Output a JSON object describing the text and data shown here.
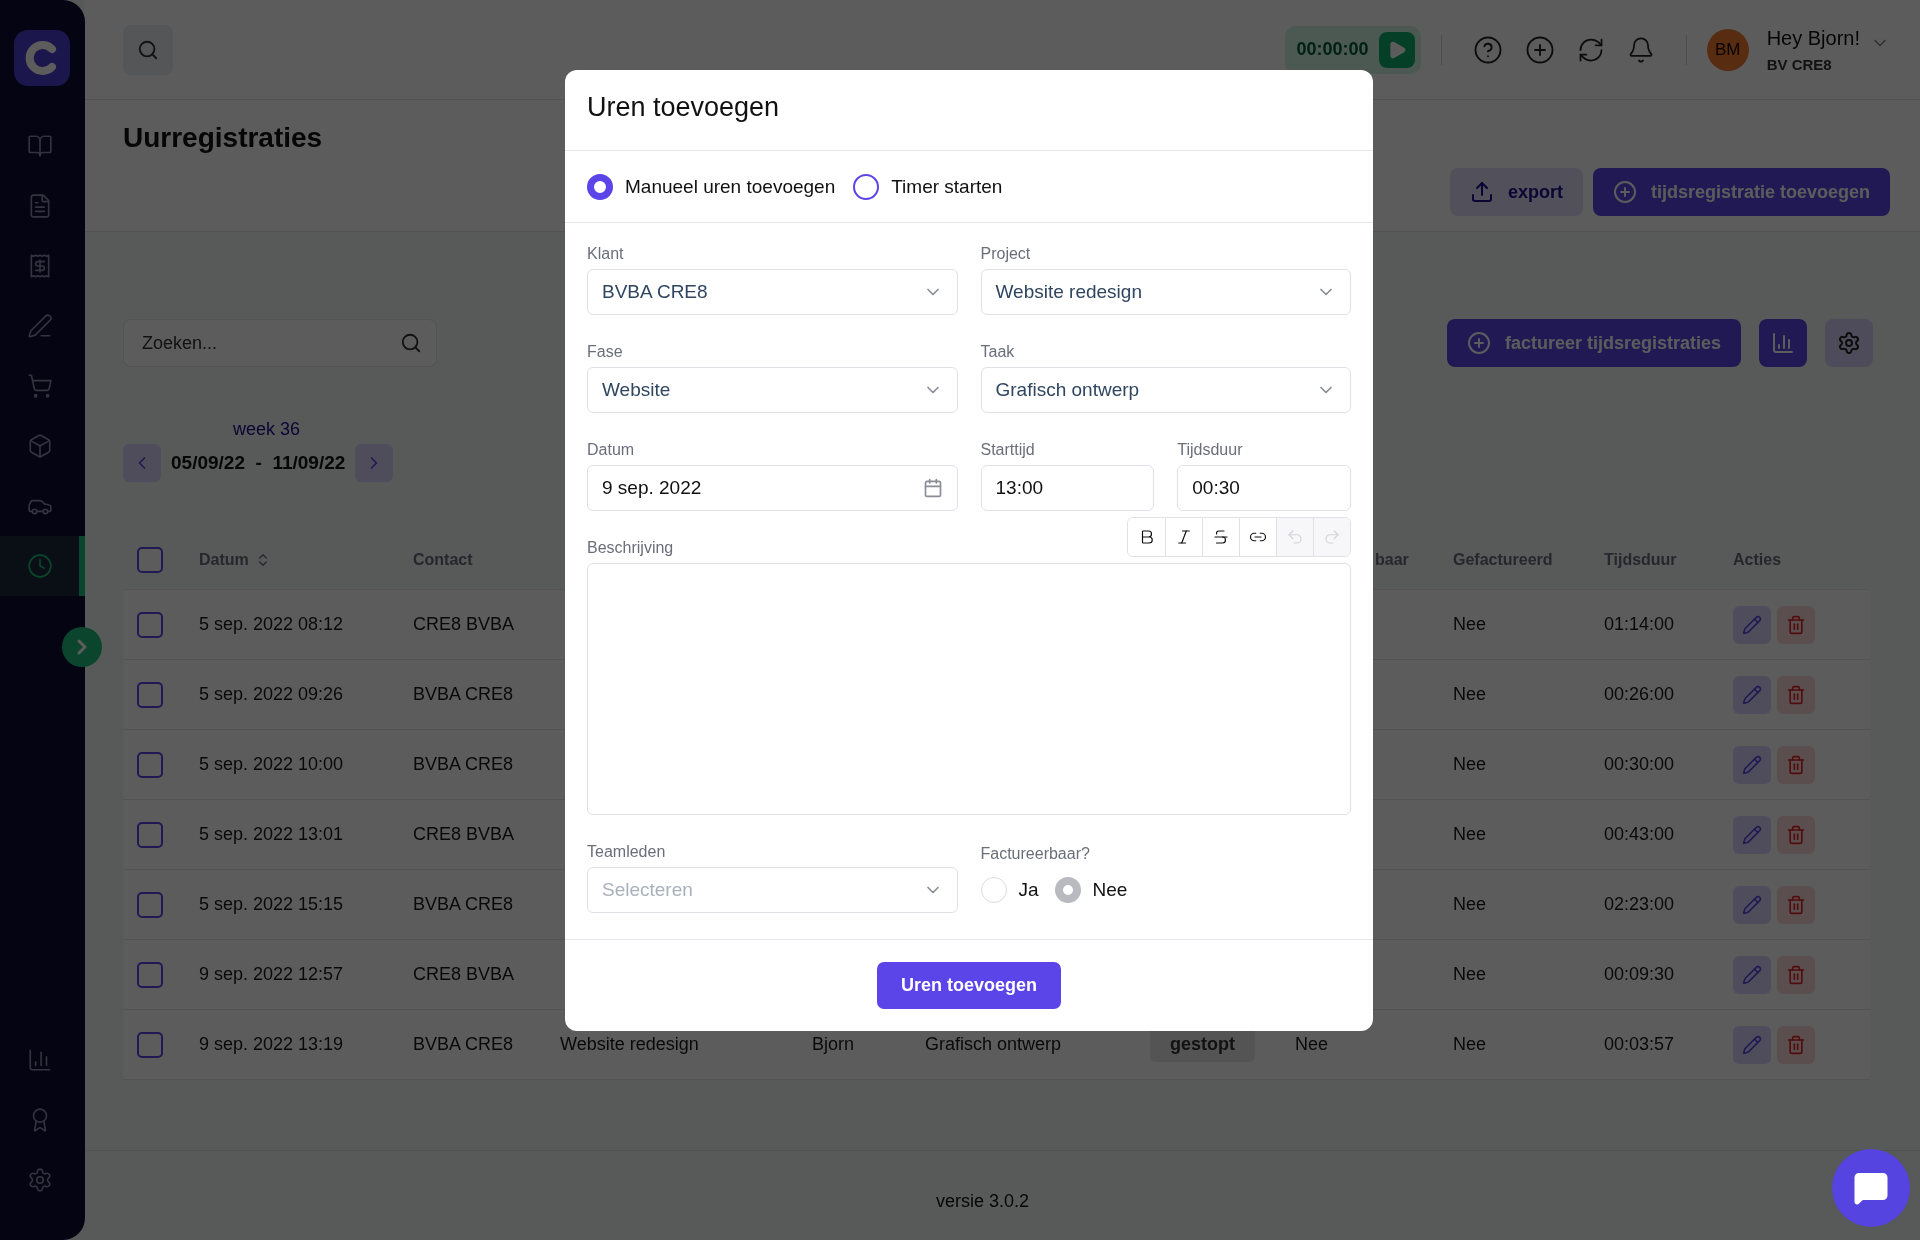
{
  "sidebar": {
    "items": [
      {
        "selected": false
      },
      {
        "selected": false
      },
      {
        "selected": false
      },
      {
        "selected": false
      },
      {
        "selected": false
      },
      {
        "selected": false
      },
      {
        "selected": false
      },
      {
        "selected": true
      }
    ],
    "bottom_items": [
      {
        "selected": false
      },
      {
        "selected": false
      },
      {
        "selected": false
      }
    ]
  },
  "topbar": {
    "timer": "00:00:00",
    "user": {
      "initials": "BM",
      "greeting": "Hey Bjorn!",
      "company": "BV CRE8"
    }
  },
  "page": {
    "title": "Uurregistraties",
    "export": "export",
    "add": "tijdsregistratie toevoegen",
    "search": {
      "placeholder": "Zoeken..."
    },
    "invoice": "factureer tijdsregistraties",
    "week": {
      "label": "week 36",
      "range": "05/09/22  -  11/09/22"
    }
  },
  "table": {
    "select_all": false,
    "header": {
      "datum": "Datum",
      "contact": "Contact",
      "column_8": "baar",
      "gefactureerd": "Gefactureerd",
      "tijdsduur": "Tijdsduur",
      "acties": "Acties"
    },
    "rows": [
      {
        "checked": false,
        "datum": "5 sep. 2022 08:12",
        "contact": "CRE8 BVBA",
        "gefactureerd": "Nee",
        "tijdsduur": "01:14:00"
      },
      {
        "checked": false,
        "datum": "5 sep. 2022 09:26",
        "contact": "BVBA CRE8",
        "gefactureerd": "Nee",
        "tijdsduur": "00:26:00"
      },
      {
        "checked": false,
        "datum": "5 sep. 2022 10:00",
        "contact": "BVBA CRE8",
        "gefactureerd": "Nee",
        "tijdsduur": "00:30:00"
      },
      {
        "checked": false,
        "datum": "5 sep. 2022 13:01",
        "contact": "CRE8 BVBA",
        "gefactureerd": "Nee",
        "tijdsduur": "00:43:00"
      },
      {
        "checked": false,
        "datum": "5 sep. 2022 15:15",
        "contact": "BVBA CRE8",
        "gefactureerd": "Nee",
        "tijdsduur": "02:23:00"
      },
      {
        "checked": false,
        "datum": "9 sep. 2022 12:57",
        "contact": "CRE8 BVBA",
        "gefactureerd": "Nee",
        "tijdsduur": "00:09:30"
      },
      {
        "checked": false,
        "datum": "9 sep. 2022 13:19",
        "contact": "BVBA CRE8",
        "column_4": "Website redesign",
        "column_5": "Bjorn",
        "column_6": "Grafisch ontwerp",
        "column_7": "gestopt",
        "column_8": "Nee",
        "gefactureerd": "Nee",
        "tijdsduur": "00:03:57"
      }
    ]
  },
  "version": "versie 3.0.2",
  "modal": {
    "title": "Uren toevoegen",
    "modes": [
      {
        "label": "Manueel uren toevoegen",
        "selected": true
      },
      {
        "label": "Timer starten",
        "selected": false
      }
    ],
    "fields": [
      {
        "label": "Klant",
        "value": "BVBA CRE8",
        "kind": "select"
      },
      {
        "label": "Project",
        "value": "Website redesign",
        "kind": "select"
      },
      {
        "label": "Fase",
        "value": "Website",
        "kind": "select"
      },
      {
        "label": "Taak",
        "value": "Grafisch ontwerp",
        "kind": "select"
      },
      {
        "label": "Datum",
        "value": "9 sep. 2022",
        "kind": "date"
      },
      {
        "label": "Starttijd",
        "value": "13:00",
        "kind": "text"
      },
      {
        "label": "Tijdsduur",
        "value": "00:30",
        "kind": "text"
      }
    ],
    "description": {
      "label": "Beschrijving",
      "toolbar": [
        {
          "kind": "bold",
          "disabled": false
        },
        {
          "kind": "italic",
          "disabled": false
        },
        {
          "kind": "strike",
          "disabled": false
        },
        {
          "kind": "link",
          "disabled": false
        },
        {
          "kind": "undo",
          "disabled": true
        },
        {
          "kind": "redo",
          "disabled": true
        }
      ]
    },
    "team": {
      "label": "Teamleden",
      "placeholder": "Selecteren"
    },
    "billable": {
      "label": "Factureerbaar?",
      "options": [
        {
          "label": "Ja",
          "selected": false
        },
        {
          "label": "Nee",
          "selected": true
        }
      ]
    },
    "submit": "Uren toevoegen"
  }
}
